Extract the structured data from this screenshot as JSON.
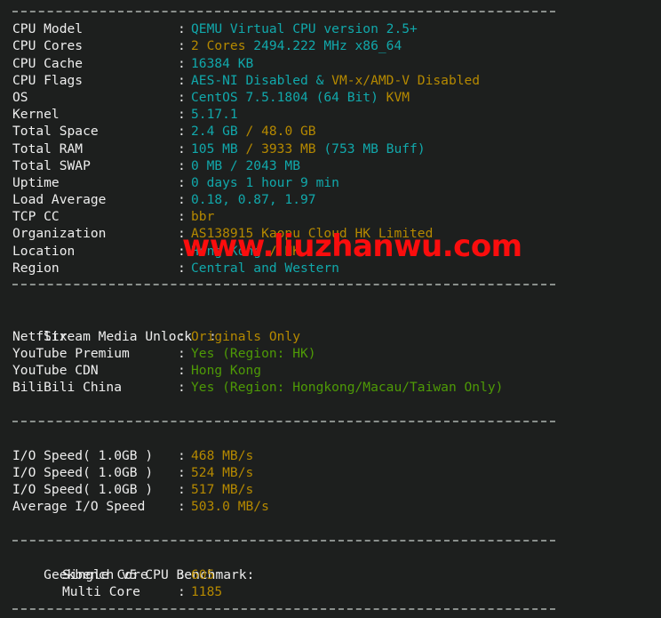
{
  "terminal": {
    "background": "#1d1f1e",
    "colors": {
      "label": "#eeeeee",
      "cyan": "#11a8ab",
      "yellow": "#b58900",
      "green": "#4e9a06",
      "rule": "#8a8f8c",
      "watermark": "#fa0d0d"
    },
    "watermark_text": "www.liuzhanwu.com",
    "colon": ":"
  },
  "system_info": {
    "rows": [
      {
        "label": "CPU Model",
        "parts": [
          {
            "text": "QEMU Virtual CPU version 2.5+",
            "color": "cyan"
          }
        ]
      },
      {
        "label": "CPU Cores",
        "parts": [
          {
            "text": "2 Cores",
            "color": "yellow"
          },
          {
            "text": " 2494.222 MHz x86_64",
            "color": "cyan"
          }
        ]
      },
      {
        "label": "CPU Cache",
        "parts": [
          {
            "text": "16384 KB",
            "color": "cyan"
          }
        ]
      },
      {
        "label": "CPU Flags",
        "parts": [
          {
            "text": "AES-NI Disabled",
            "color": "cyan"
          },
          {
            "text": " & ",
            "color": "cyan"
          },
          {
            "text": "VM-x/AMD-V Disabled",
            "color": "yellow"
          }
        ]
      },
      {
        "label": "OS",
        "parts": [
          {
            "text": "CentOS 7.5.1804 (64 Bit) ",
            "color": "cyan"
          },
          {
            "text": "KVM",
            "color": "yellow"
          }
        ]
      },
      {
        "label": "Kernel",
        "parts": [
          {
            "text": "5.17.1",
            "color": "cyan"
          }
        ]
      },
      {
        "label": "Total Space",
        "parts": [
          {
            "text": "2.4 GB ",
            "color": "cyan"
          },
          {
            "text": "/ 48.0 GB",
            "color": "yellow"
          }
        ]
      },
      {
        "label": "Total RAM",
        "parts": [
          {
            "text": "105 MB ",
            "color": "cyan"
          },
          {
            "text": "/ 3933 MB ",
            "color": "yellow"
          },
          {
            "text": "(753 MB Buff)",
            "color": "cyan"
          }
        ]
      },
      {
        "label": "Total SWAP",
        "parts": [
          {
            "text": "0 MB / 2043 MB",
            "color": "cyan"
          }
        ]
      },
      {
        "label": "Uptime",
        "parts": [
          {
            "text": "0 days 1 hour 9 min",
            "color": "cyan"
          }
        ]
      },
      {
        "label": "Load Average",
        "parts": [
          {
            "text": "0.18, 0.87, 1.97",
            "color": "cyan"
          }
        ]
      },
      {
        "label": "TCP CC",
        "parts": [
          {
            "text": "bbr",
            "color": "yellow"
          }
        ]
      },
      {
        "label": "Organization",
        "parts": [
          {
            "text": "AS138915 Kaopu Cloud HK Limited",
            "color": "yellow"
          }
        ]
      },
      {
        "label": "Location",
        "parts": [
          {
            "text": "Hong Kong ",
            "color": "cyan"
          },
          {
            "text": "/ HK",
            "color": "yellow"
          }
        ]
      },
      {
        "label": "Region",
        "parts": [
          {
            "text": "Central and Western",
            "color": "cyan"
          }
        ]
      }
    ]
  },
  "stream_media": {
    "heading": "Stream Media Unlock",
    "rows": [
      {
        "label": "Netflix",
        "parts": [
          {
            "text": "Originals Only",
            "color": "yellow"
          }
        ]
      },
      {
        "label": "YouTube Premium",
        "parts": [
          {
            "text": "Yes (Region: HK)",
            "color": "green"
          }
        ]
      },
      {
        "label": "YouTube CDN",
        "parts": [
          {
            "text": "Hong Kong",
            "color": "green"
          }
        ]
      },
      {
        "label": "BiliBili China",
        "parts": [
          {
            "text": "Yes (Region: Hongkong/Macau/Taiwan Only)",
            "color": "green"
          }
        ]
      }
    ]
  },
  "io_speed": {
    "rows": [
      {
        "label": "I/O Speed( 1.0GB )",
        "parts": [
          {
            "text": "468 MB/s",
            "color": "yellow"
          }
        ]
      },
      {
        "label": "I/O Speed( 1.0GB )",
        "parts": [
          {
            "text": "524 MB/s",
            "color": "yellow"
          }
        ]
      },
      {
        "label": "I/O Speed( 1.0GB )",
        "parts": [
          {
            "text": "517 MB/s",
            "color": "yellow"
          }
        ]
      },
      {
        "label": "Average I/O Speed",
        "parts": [
          {
            "text": "503.0 MB/s",
            "color": "yellow"
          }
        ]
      }
    ]
  },
  "geekbench": {
    "heading": "Geekbench v5 CPU Benchmark:",
    "rows": [
      {
        "label": "Single Core",
        "indent": true,
        "parts": [
          {
            "text": "605",
            "color": "yellow"
          }
        ]
      },
      {
        "label": "Multi Core",
        "indent": true,
        "parts": [
          {
            "text": "1185",
            "color": "yellow"
          }
        ]
      }
    ]
  }
}
